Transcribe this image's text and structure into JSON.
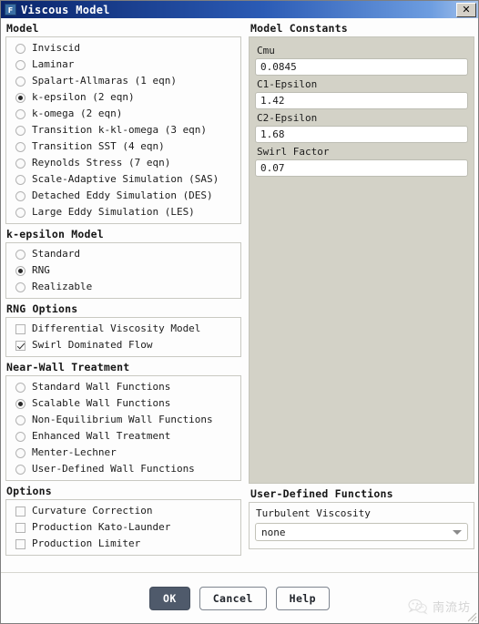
{
  "window": {
    "title": "Viscous Model",
    "icon_label": "F",
    "close_label": "✕"
  },
  "model": {
    "group_label": "Model",
    "options": [
      {
        "label": "Inviscid",
        "selected": false
      },
      {
        "label": "Laminar",
        "selected": false
      },
      {
        "label": "Spalart-Allmaras (1 eqn)",
        "selected": false
      },
      {
        "label": "k-epsilon (2 eqn)",
        "selected": true
      },
      {
        "label": "k-omega (2 eqn)",
        "selected": false
      },
      {
        "label": "Transition k-kl-omega (3 eqn)",
        "selected": false
      },
      {
        "label": "Transition SST (4 eqn)",
        "selected": false
      },
      {
        "label": "Reynolds Stress (7 eqn)",
        "selected": false
      },
      {
        "label": "Scale-Adaptive Simulation (SAS)",
        "selected": false
      },
      {
        "label": "Detached Eddy Simulation (DES)",
        "selected": false
      },
      {
        "label": "Large Eddy Simulation (LES)",
        "selected": false
      }
    ]
  },
  "k_epsilon_model": {
    "group_label": "k-epsilon Model",
    "options": [
      {
        "label": "Standard",
        "selected": false
      },
      {
        "label": "RNG",
        "selected": true
      },
      {
        "label": "Realizable",
        "selected": false
      }
    ]
  },
  "rng_options": {
    "group_label": "RNG Options",
    "options": [
      {
        "label": "Differential Viscosity Model",
        "checked": false
      },
      {
        "label": "Swirl Dominated Flow",
        "checked": true
      }
    ]
  },
  "near_wall_treatment": {
    "group_label": "Near-Wall Treatment",
    "options": [
      {
        "label": "Standard Wall Functions",
        "selected": false
      },
      {
        "label": "Scalable Wall Functions",
        "selected": true
      },
      {
        "label": "Non-Equilibrium Wall Functions",
        "selected": false
      },
      {
        "label": "Enhanced Wall Treatment",
        "selected": false
      },
      {
        "label": "Menter-Lechner",
        "selected": false
      },
      {
        "label": "User-Defined Wall Functions",
        "selected": false
      }
    ]
  },
  "options": {
    "group_label": "Options",
    "items": [
      {
        "label": "Curvature Correction",
        "checked": false
      },
      {
        "label": "Production Kato-Launder",
        "checked": false
      },
      {
        "label": "Production Limiter",
        "checked": false
      }
    ]
  },
  "model_constants": {
    "group_label": "Model Constants",
    "fields": [
      {
        "label": "Cmu",
        "value": "0.0845"
      },
      {
        "label": "C1-Epsilon",
        "value": "1.42"
      },
      {
        "label": "C2-Epsilon",
        "value": "1.68"
      },
      {
        "label": "Swirl Factor",
        "value": "0.07"
      }
    ]
  },
  "user_defined_functions": {
    "group_label": "User-Defined Functions",
    "field_label": "Turbulent Viscosity",
    "selected": "none"
  },
  "footer": {
    "ok_label": "OK",
    "cancel_label": "Cancel",
    "help_label": "Help"
  },
  "watermark": {
    "text": "南流坊"
  },
  "colors": {
    "titlebar_start": "#0a246a",
    "titlebar_end": "#a7c4ec",
    "panel_beige": "#d3d2c7",
    "primary_button": "#4f5a6b",
    "body_bg": "#fdfdfd"
  }
}
